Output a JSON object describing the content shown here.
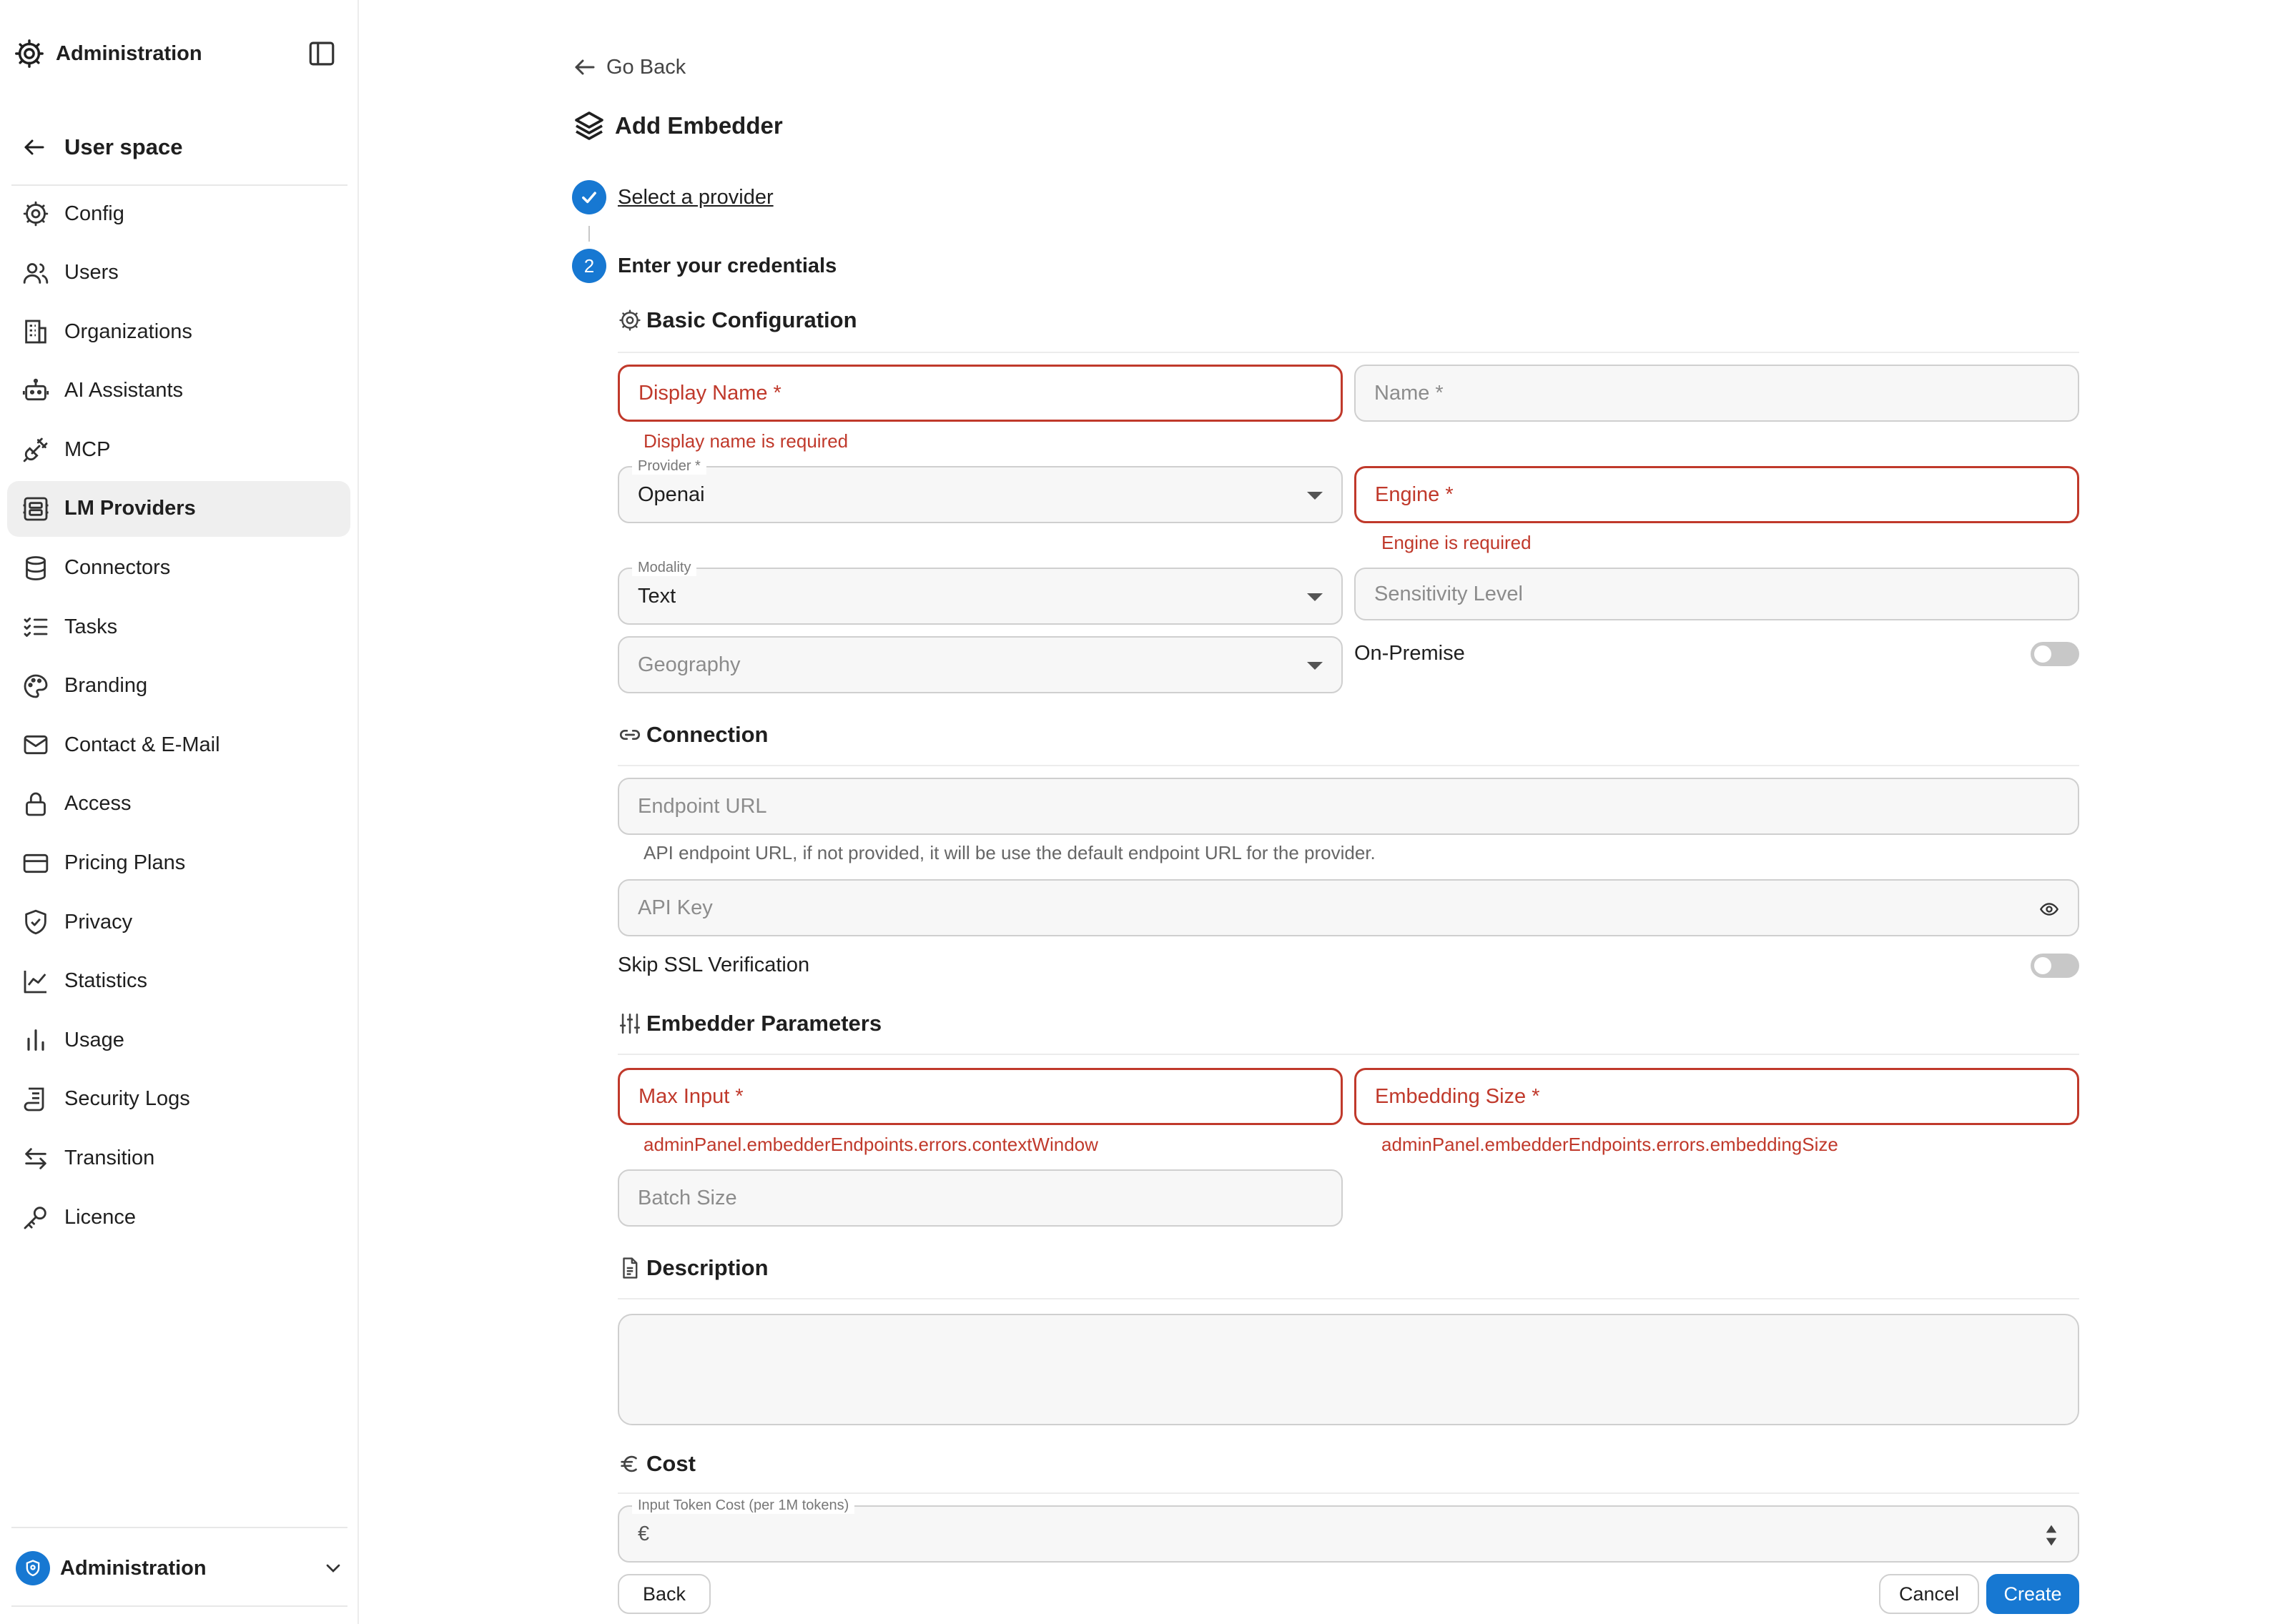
{
  "sidebar": {
    "title": "Administration",
    "back_label": "User space",
    "items": [
      {
        "label": "Config",
        "icon": "gear-icon"
      },
      {
        "label": "Users",
        "icon": "users-icon"
      },
      {
        "label": "Organizations",
        "icon": "building-icon"
      },
      {
        "label": "AI Assistants",
        "icon": "robot-icon"
      },
      {
        "label": "MCP",
        "icon": "plug-icon"
      },
      {
        "label": "LM Providers",
        "icon": "server-icon",
        "active": true
      },
      {
        "label": "Connectors",
        "icon": "database-icon"
      },
      {
        "label": "Tasks",
        "icon": "checklist-icon"
      },
      {
        "label": "Branding",
        "icon": "palette-icon"
      },
      {
        "label": "Contact & E-Mail",
        "icon": "mail-icon"
      },
      {
        "label": "Access",
        "icon": "lock-icon"
      },
      {
        "label": "Pricing Plans",
        "icon": "credit-card-icon"
      },
      {
        "label": "Privacy",
        "icon": "shield-icon"
      },
      {
        "label": "Statistics",
        "icon": "line-chart-icon"
      },
      {
        "label": "Usage",
        "icon": "bar-chart-icon"
      },
      {
        "label": "Security Logs",
        "icon": "scroll-icon"
      },
      {
        "label": "Transition",
        "icon": "arrows-swap-icon"
      },
      {
        "label": "Licence",
        "icon": "key-icon"
      }
    ],
    "switcher_label": "Administration"
  },
  "main": {
    "go_back": "Go Back",
    "title": "Add Embedder",
    "steps": [
      {
        "number": "",
        "label": "Select a provider",
        "done": true
      },
      {
        "number": "2",
        "label": "Enter your credentials",
        "done": false
      }
    ],
    "basic": {
      "heading": "Basic Configuration",
      "display_name": "Display Name *",
      "display_name_error": "Display name is required",
      "name": "Name *",
      "provider_label": "Provider *",
      "provider_value": "Openai",
      "engine": "Engine *",
      "engine_error": "Engine is required",
      "modality_label": "Modality",
      "modality_value": "Text",
      "sensitivity": "Sensitivity Level",
      "geography": "Geography",
      "on_premise": "On-Premise",
      "on_premise_enabled": false
    },
    "connection": {
      "heading": "Connection",
      "endpoint_placeholder": "Endpoint URL",
      "endpoint_help": "API endpoint URL, if not provided, it will be use the default endpoint URL for the provider.",
      "api_key_placeholder": "API Key",
      "skip_ssl": "Skip SSL Verification",
      "skip_ssl_enabled": false
    },
    "params": {
      "heading": "Embedder Parameters",
      "max_input": "Max Input *",
      "max_input_error": "adminPanel.embedderEndpoints.errors.contextWindow",
      "embedding_size": "Embedding Size *",
      "embedding_size_error": "adminPanel.embedderEndpoints.errors.embeddingSize",
      "batch_size": "Batch Size"
    },
    "description": {
      "heading": "Description",
      "value": ""
    },
    "cost": {
      "heading": "Cost",
      "input_label": "Input Token Cost (per 1M tokens)",
      "currency": "€"
    },
    "actions": {
      "back": "Back",
      "cancel": "Cancel",
      "create": "Create"
    }
  },
  "colors": {
    "accent": "#1778d2",
    "error": "#c0392b",
    "active_nav_bg": "#efefef"
  }
}
